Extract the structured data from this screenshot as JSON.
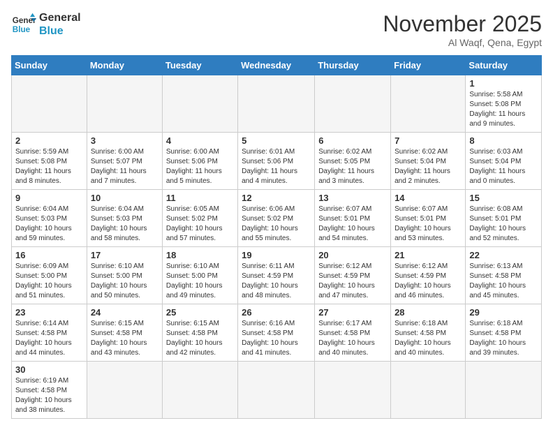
{
  "logo": {
    "line1": "General",
    "line2": "Blue"
  },
  "title": "November 2025",
  "location": "Al Waqf, Qena, Egypt",
  "weekdays": [
    "Sunday",
    "Monday",
    "Tuesday",
    "Wednesday",
    "Thursday",
    "Friday",
    "Saturday"
  ],
  "weeks": [
    [
      {
        "day": "",
        "info": ""
      },
      {
        "day": "",
        "info": ""
      },
      {
        "day": "",
        "info": ""
      },
      {
        "day": "",
        "info": ""
      },
      {
        "day": "",
        "info": ""
      },
      {
        "day": "",
        "info": ""
      },
      {
        "day": "1",
        "info": "Sunrise: 5:58 AM\nSunset: 5:08 PM\nDaylight: 11 hours and 9 minutes."
      }
    ],
    [
      {
        "day": "2",
        "info": "Sunrise: 5:59 AM\nSunset: 5:08 PM\nDaylight: 11 hours and 8 minutes."
      },
      {
        "day": "3",
        "info": "Sunrise: 6:00 AM\nSunset: 5:07 PM\nDaylight: 11 hours and 7 minutes."
      },
      {
        "day": "4",
        "info": "Sunrise: 6:00 AM\nSunset: 5:06 PM\nDaylight: 11 hours and 5 minutes."
      },
      {
        "day": "5",
        "info": "Sunrise: 6:01 AM\nSunset: 5:06 PM\nDaylight: 11 hours and 4 minutes."
      },
      {
        "day": "6",
        "info": "Sunrise: 6:02 AM\nSunset: 5:05 PM\nDaylight: 11 hours and 3 minutes."
      },
      {
        "day": "7",
        "info": "Sunrise: 6:02 AM\nSunset: 5:04 PM\nDaylight: 11 hours and 2 minutes."
      },
      {
        "day": "8",
        "info": "Sunrise: 6:03 AM\nSunset: 5:04 PM\nDaylight: 11 hours and 0 minutes."
      }
    ],
    [
      {
        "day": "9",
        "info": "Sunrise: 6:04 AM\nSunset: 5:03 PM\nDaylight: 10 hours and 59 minutes."
      },
      {
        "day": "10",
        "info": "Sunrise: 6:04 AM\nSunset: 5:03 PM\nDaylight: 10 hours and 58 minutes."
      },
      {
        "day": "11",
        "info": "Sunrise: 6:05 AM\nSunset: 5:02 PM\nDaylight: 10 hours and 57 minutes."
      },
      {
        "day": "12",
        "info": "Sunrise: 6:06 AM\nSunset: 5:02 PM\nDaylight: 10 hours and 55 minutes."
      },
      {
        "day": "13",
        "info": "Sunrise: 6:07 AM\nSunset: 5:01 PM\nDaylight: 10 hours and 54 minutes."
      },
      {
        "day": "14",
        "info": "Sunrise: 6:07 AM\nSunset: 5:01 PM\nDaylight: 10 hours and 53 minutes."
      },
      {
        "day": "15",
        "info": "Sunrise: 6:08 AM\nSunset: 5:01 PM\nDaylight: 10 hours and 52 minutes."
      }
    ],
    [
      {
        "day": "16",
        "info": "Sunrise: 6:09 AM\nSunset: 5:00 PM\nDaylight: 10 hours and 51 minutes."
      },
      {
        "day": "17",
        "info": "Sunrise: 6:10 AM\nSunset: 5:00 PM\nDaylight: 10 hours and 50 minutes."
      },
      {
        "day": "18",
        "info": "Sunrise: 6:10 AM\nSunset: 5:00 PM\nDaylight: 10 hours and 49 minutes."
      },
      {
        "day": "19",
        "info": "Sunrise: 6:11 AM\nSunset: 4:59 PM\nDaylight: 10 hours and 48 minutes."
      },
      {
        "day": "20",
        "info": "Sunrise: 6:12 AM\nSunset: 4:59 PM\nDaylight: 10 hours and 47 minutes."
      },
      {
        "day": "21",
        "info": "Sunrise: 6:12 AM\nSunset: 4:59 PM\nDaylight: 10 hours and 46 minutes."
      },
      {
        "day": "22",
        "info": "Sunrise: 6:13 AM\nSunset: 4:58 PM\nDaylight: 10 hours and 45 minutes."
      }
    ],
    [
      {
        "day": "23",
        "info": "Sunrise: 6:14 AM\nSunset: 4:58 PM\nDaylight: 10 hours and 44 minutes."
      },
      {
        "day": "24",
        "info": "Sunrise: 6:15 AM\nSunset: 4:58 PM\nDaylight: 10 hours and 43 minutes."
      },
      {
        "day": "25",
        "info": "Sunrise: 6:15 AM\nSunset: 4:58 PM\nDaylight: 10 hours and 42 minutes."
      },
      {
        "day": "26",
        "info": "Sunrise: 6:16 AM\nSunset: 4:58 PM\nDaylight: 10 hours and 41 minutes."
      },
      {
        "day": "27",
        "info": "Sunrise: 6:17 AM\nSunset: 4:58 PM\nDaylight: 10 hours and 40 minutes."
      },
      {
        "day": "28",
        "info": "Sunrise: 6:18 AM\nSunset: 4:58 PM\nDaylight: 10 hours and 40 minutes."
      },
      {
        "day": "29",
        "info": "Sunrise: 6:18 AM\nSunset: 4:58 PM\nDaylight: 10 hours and 39 minutes."
      }
    ],
    [
      {
        "day": "30",
        "info": "Sunrise: 6:19 AM\nSunset: 4:58 PM\nDaylight: 10 hours and 38 minutes."
      },
      {
        "day": "",
        "info": ""
      },
      {
        "day": "",
        "info": ""
      },
      {
        "day": "",
        "info": ""
      },
      {
        "day": "",
        "info": ""
      },
      {
        "day": "",
        "info": ""
      },
      {
        "day": "",
        "info": ""
      }
    ]
  ]
}
